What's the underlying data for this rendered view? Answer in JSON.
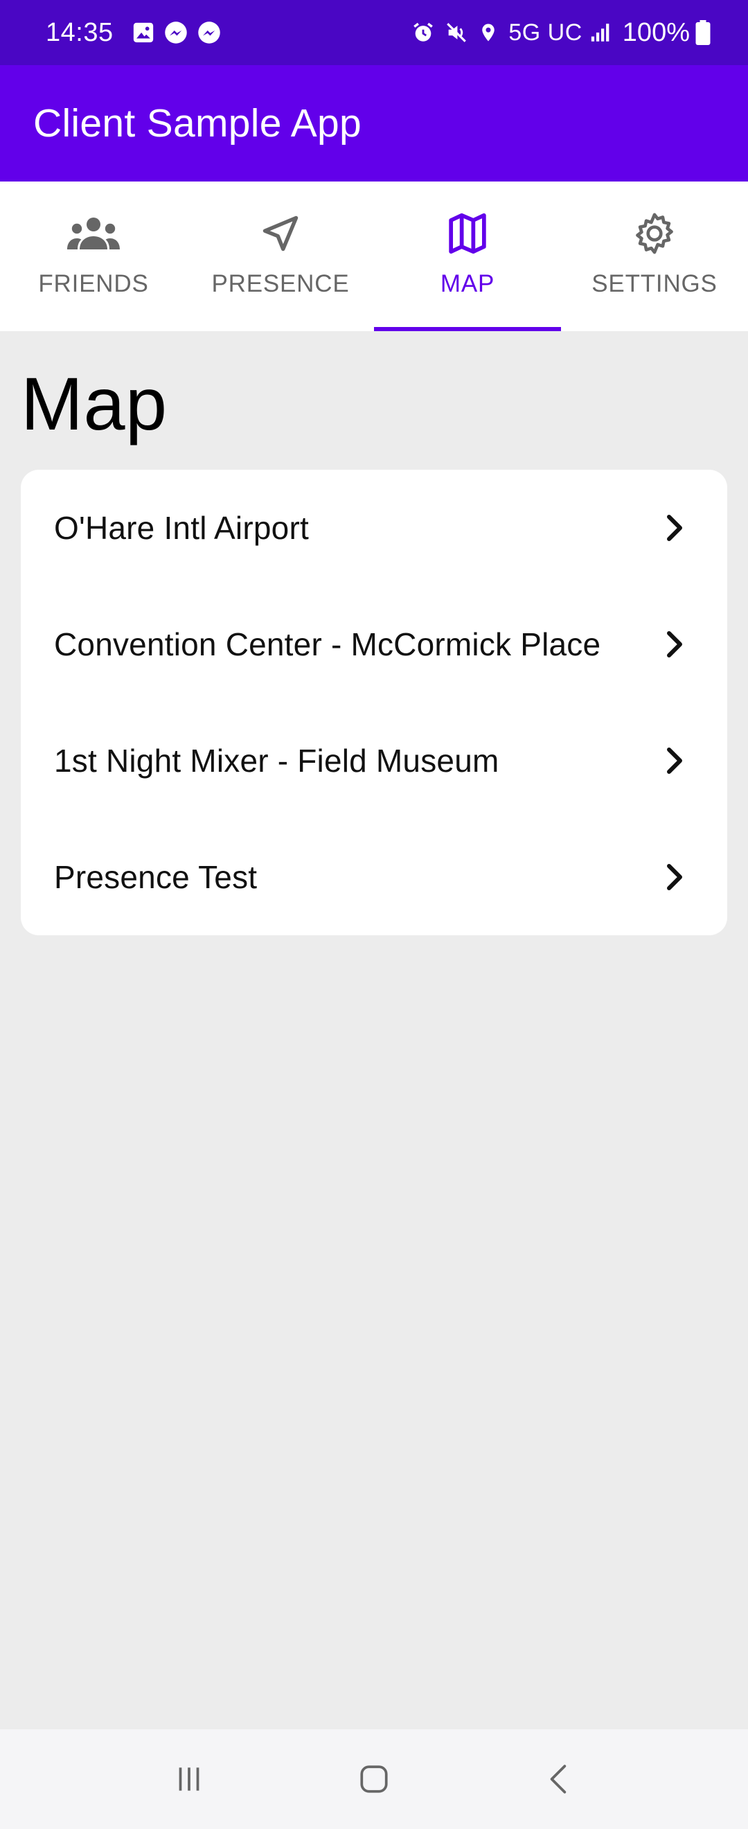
{
  "status_bar": {
    "time": "14:35",
    "left_icons": [
      "gallery-icon",
      "messenger-icon",
      "messenger-icon"
    ],
    "right_icons": [
      "alarm-icon",
      "mute-icon",
      "location-icon"
    ],
    "network": "5G UC",
    "battery": "100%"
  },
  "app_bar": {
    "title": "Client Sample App",
    "color": "#6200ea"
  },
  "tabs": [
    {
      "label": "FRIENDS",
      "icon": "people-icon",
      "active": false
    },
    {
      "label": "PRESENCE",
      "icon": "navigation-arrow-icon",
      "active": false
    },
    {
      "label": "MAP",
      "icon": "map-icon",
      "active": true
    },
    {
      "label": "SETTINGS",
      "icon": "gear-icon",
      "active": false
    }
  ],
  "main": {
    "title": "Map",
    "items": [
      {
        "label": "O'Hare Intl Airport"
      },
      {
        "label": "Convention Center - McCormick Place"
      },
      {
        "label": "1st Night Mixer - Field Museum"
      },
      {
        "label": "Presence Test"
      }
    ]
  },
  "colors": {
    "status_bar": "#4a06c4",
    "accent": "#6200ea",
    "background": "#ececec"
  }
}
